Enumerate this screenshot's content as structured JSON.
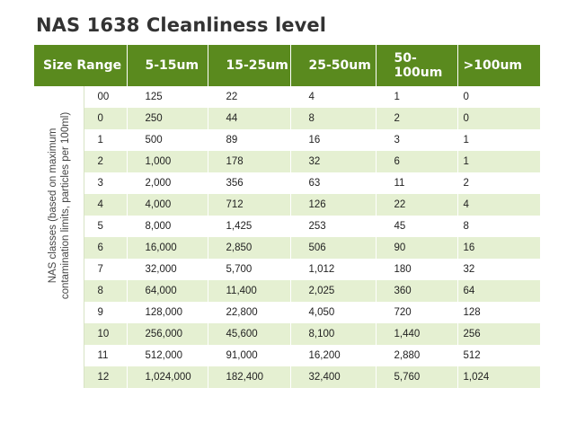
{
  "title": "NAS 1638 Cleanliness level",
  "header": {
    "size_range": "Size Range",
    "columns": [
      "5-15um",
      "15-25um",
      "25-50um",
      "50-100um",
      ">100um"
    ]
  },
  "side_label": {
    "line1": "NAS classes (based on maximum",
    "line2": "contamination limits, particles per 100ml)"
  },
  "rows": [
    {
      "class": "00",
      "values": [
        "125",
        "22",
        "4",
        "1",
        "0"
      ]
    },
    {
      "class": "0",
      "values": [
        "250",
        "44",
        "8",
        "2",
        "0"
      ]
    },
    {
      "class": "1",
      "values": [
        "500",
        "89",
        "16",
        "3",
        "1"
      ]
    },
    {
      "class": "2",
      "values": [
        "1,000",
        "178",
        "32",
        "6",
        "1"
      ]
    },
    {
      "class": "3",
      "values": [
        "2,000",
        "356",
        "63",
        "11",
        "2"
      ]
    },
    {
      "class": "4",
      "values": [
        "4,000",
        "712",
        "126",
        "22",
        "4"
      ]
    },
    {
      "class": "5",
      "values": [
        "8,000",
        "1,425",
        "253",
        "45",
        "8"
      ]
    },
    {
      "class": "6",
      "values": [
        "16,000",
        "2,850",
        "506",
        "90",
        "16"
      ]
    },
    {
      "class": "7",
      "values": [
        "32,000",
        "5,700",
        "1,012",
        "180",
        "32"
      ]
    },
    {
      "class": "8",
      "values": [
        "64,000",
        "11,400",
        "2,025",
        "360",
        "64"
      ]
    },
    {
      "class": "9",
      "values": [
        "128,000",
        "22,800",
        "4,050",
        "720",
        "128"
      ]
    },
    {
      "class": "10",
      "values": [
        "256,000",
        "45,600",
        "8,100",
        "1,440",
        "256"
      ]
    },
    {
      "class": "11",
      "values": [
        "512,000",
        "91,000",
        "16,200",
        "2,880",
        "512"
      ]
    },
    {
      "class": "12",
      "values": [
        "1,024,000",
        "182,400",
        "32,400",
        "5,760",
        "1,024"
      ]
    }
  ],
  "colors": {
    "header_bg": "#5a8a1e",
    "row_shade": "#e5f0d2"
  }
}
